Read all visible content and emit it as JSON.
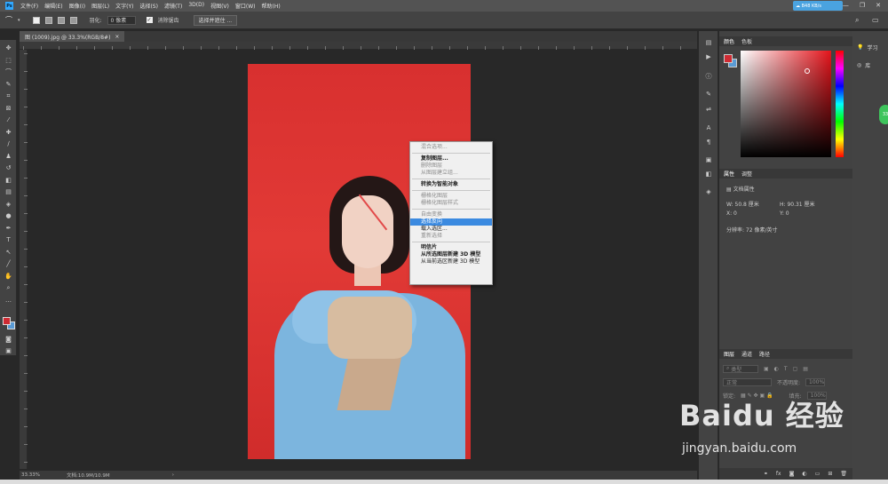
{
  "menu": {
    "logo": "Ps",
    "items": [
      "文件(F)",
      "编辑(E)",
      "图像(I)",
      "图层(L)",
      "文字(Y)",
      "选择(S)",
      "滤镜(T)",
      "3D(D)",
      "视图(V)",
      "窗口(W)",
      "帮助(H)"
    ],
    "cloud": "B48 KB/s"
  },
  "options": {
    "feather_label": "羽化:",
    "feather_value": "0 像素",
    "antialias_label": "消除锯齿",
    "select_mask_button": "选择并遮住 ..."
  },
  "document": {
    "tab_title": "图 (1009).jpg @ 33.3%(RGB/8#)",
    "tab_close": "×"
  },
  "context_menu": [
    {
      "label": "混合选项...",
      "style": "dim"
    },
    {
      "sep": true
    },
    {
      "label": "复制图层...",
      "style": "bold"
    },
    {
      "label": "删除图层",
      "style": "dim"
    },
    {
      "label": "从图层建立组...",
      "style": "dim"
    },
    {
      "sep": true
    },
    {
      "label": "转换为智能对象",
      "style": "bold"
    },
    {
      "sep": true
    },
    {
      "label": "栅格化图层",
      "style": "dim"
    },
    {
      "label": "栅格化图层样式",
      "style": "dim"
    },
    {
      "sep": true
    },
    {
      "label": "自由变换",
      "style": "dim"
    },
    {
      "label": "选择反向",
      "style": "sel"
    },
    {
      "label": "载入选区...",
      "style": "normal"
    },
    {
      "label": "重新选择",
      "style": "dim"
    },
    {
      "sep": true
    },
    {
      "label": "明信片",
      "style": "bold"
    },
    {
      "label": "从所选图层新建 3D 模型",
      "style": "bold"
    },
    {
      "label": "从当前选区新建 3D 模型",
      "style": "normal"
    }
  ],
  "status": {
    "zoom": "33.33%",
    "doc": "文档:10.9M/10.9M",
    "arrow": "›"
  },
  "color_panel": {
    "tabs": [
      "颜色",
      "色板"
    ],
    "fg_color": "#cf2b33",
    "bg_color": "#5a9bd5"
  },
  "properties_panel": {
    "tabs": [
      "属性",
      "调整"
    ],
    "title": "文档属性",
    "w": "W:  50.8 厘米",
    "h": "H:  90.31 厘米",
    "x": "X:  0",
    "y": "Y:  0",
    "resolution": "分辨率: 72 像素/英寸"
  },
  "layers_panel": {
    "tabs": [
      "图层",
      "通道",
      "路径"
    ],
    "kind": "类型",
    "blend": "正常",
    "opacity_label": "不透明度:",
    "opacity": "100%",
    "lock_label": "锁定:",
    "fill_label": "填充:",
    "fill": "100%"
  },
  "right_bar": {
    "learn": "学习",
    "library": "库",
    "badge": "33"
  },
  "watermark": {
    "brand": "Baidu 经验",
    "url": "jingyan.baidu.com"
  }
}
